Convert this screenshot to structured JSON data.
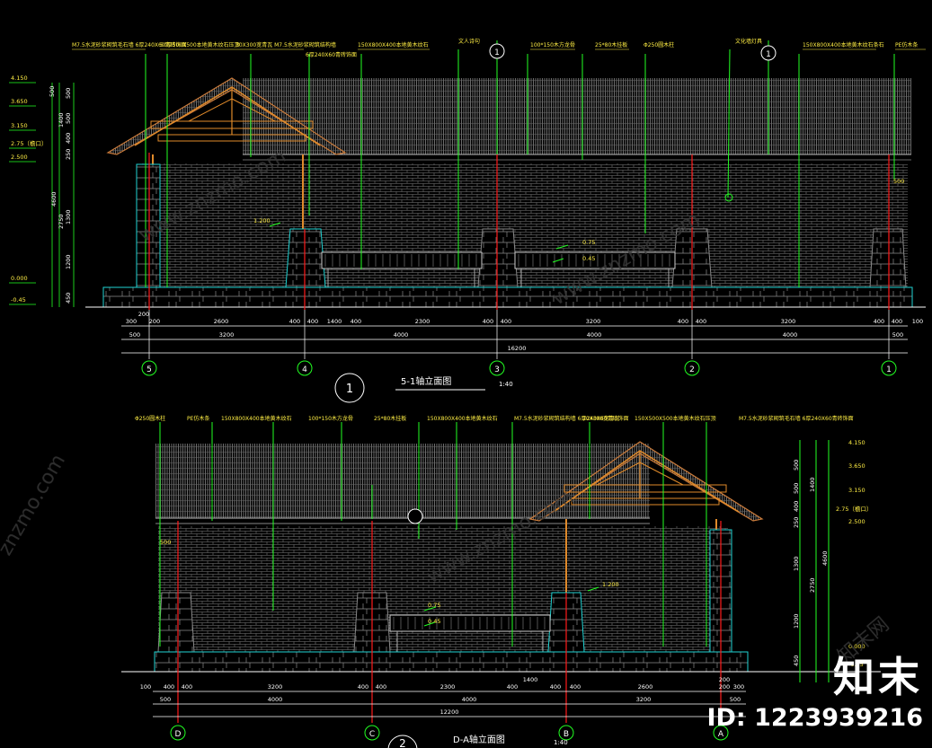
{
  "colors": {
    "background": "#000000",
    "brick": "#8a8a8a",
    "column_line": "#ff1a1a",
    "leader_line": "#22ff22",
    "dimension": "#ffffff",
    "stone": "#1fd3d3",
    "timber": "#e08a2a",
    "roof_tile": "#9a9a9a",
    "annotation_yellow": "#ffee44",
    "annotation_white": "#ffffff"
  },
  "drawing1": {
    "title": "5-1轴立面图",
    "number": "1",
    "scale": "1:40",
    "notes": [
      "M7.5水泥砂浆砌筑毛石墙 6厚240X60青砖饰面",
      "50厚500X500本地黄木纹石压顶",
      "30X300宽青瓦 M7.5水泥砂浆砌筑结构墙",
      "6厚240X60青砖饰面",
      "150X800X400本地黄木纹石",
      "文人诗句",
      "100*150木方龙骨",
      "25*80木挂板",
      "Φ250圆木柱",
      "文化墙灯具",
      "150X800X400本地黄木纹石条石",
      "PE仿木条"
    ],
    "elevations": [
      "4.150",
      "3.650",
      "3.150",
      "2.75（檐口）",
      "2.500",
      "0.000",
      "-0.45"
    ],
    "level_marks": [
      "1.200",
      "0.75",
      "0.45"
    ],
    "height_dims": [
      "500",
      "500",
      "400",
      "250",
      "1300",
      "1200",
      "450",
      "1400",
      "2750",
      "4600"
    ],
    "dims_row1": [
      "300",
      "200",
      "2600",
      "400",
      "400",
      "400",
      "2300",
      "400",
      "400",
      "3200",
      "400",
      "400",
      "3200",
      "400",
      "400",
      "100"
    ],
    "dims_row1_extra": [
      "200",
      "1400"
    ],
    "dims_row2": [
      "500",
      "3200",
      "4000",
      "4000",
      "4000",
      "500"
    ],
    "total": "16200",
    "axes": [
      "5",
      "4",
      "3",
      "2",
      "1"
    ],
    "section_marks": [
      "1",
      "1"
    ],
    "eave_dim": "500"
  },
  "drawing2": {
    "title": "D-A轴立面图",
    "number": "2",
    "scale": "1:40",
    "notes": [
      "Φ250圆木柱",
      "PE仿木条",
      "150X800X400本地黄木纹石",
      "100*150木方龙骨",
      "25*80木挂板",
      "150X800X400本地黄木纹石",
      "M7.5水泥砂浆砌筑结构墙 6厚240X60青砖饰面",
      "30X300宽青瓦",
      "150X500X500本地黄木纹石压顶",
      "M7.5水泥砂浆砌筑毛石墙 6厚240X60青砖饰面"
    ],
    "elevations": [
      "4.150",
      "3.650",
      "3.150",
      "2.75（檐口）",
      "2.500",
      "0.000",
      "-0.45"
    ],
    "level_marks": [
      "1.200",
      "0.75",
      "0.45"
    ],
    "height_dims": [
      "500",
      "500",
      "400",
      "250",
      "1300",
      "1200",
      "450",
      "1400",
      "2750",
      "4600"
    ],
    "dims_row1": [
      "100",
      "400",
      "400",
      "3200",
      "400",
      "400",
      "2300",
      "400",
      "400",
      "400",
      "2600",
      "200",
      "300"
    ],
    "dims_row1_extra": [
      "1400",
      "200"
    ],
    "dims_row2": [
      "500",
      "4000",
      "4000",
      "3200",
      "500"
    ],
    "total": "12200",
    "axes": [
      "D",
      "C",
      "B",
      "A"
    ],
    "eave_dim": "500"
  },
  "watermark": {
    "logo": "知末",
    "id_text": "ID: 1223939216",
    "url": "www.znzmo.com",
    "side": "znzmo.com",
    "side2": "知末网"
  }
}
